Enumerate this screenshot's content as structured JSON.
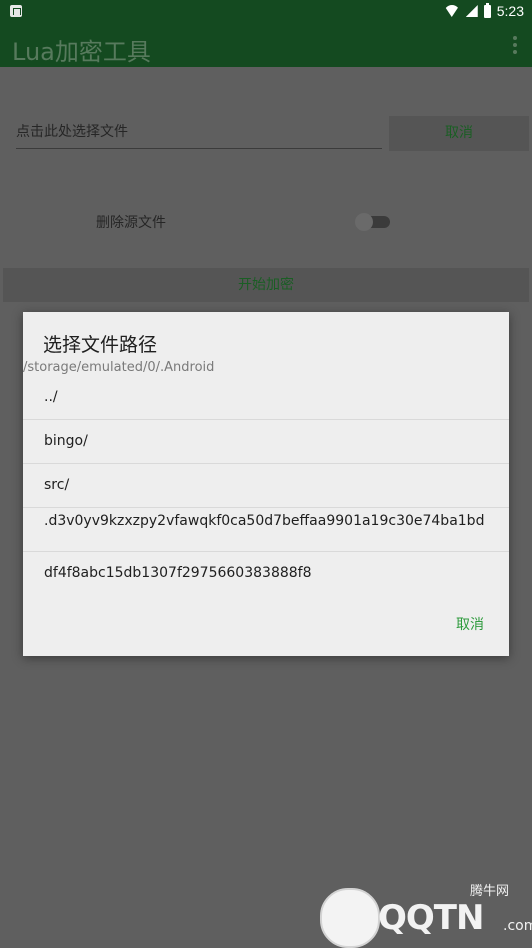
{
  "status_bar": {
    "time": "5:23",
    "icons": [
      "notification-icon",
      "wifi-icon",
      "signal-icon",
      "battery-icon"
    ]
  },
  "app": {
    "title": "Lua加密工具",
    "menu_icon": "more-vert-icon"
  },
  "main": {
    "file_input_placeholder": "点击此处选择文件",
    "cancel_label": "取消",
    "delete_source_label": "删除源文件",
    "delete_source_enabled": false,
    "start_button_label": "开始加密"
  },
  "dialog": {
    "title": "选择文件路径",
    "path": "/storage/emulated/0/.Android",
    "items": [
      {
        "label": "../"
      },
      {
        "label": "bingo/"
      },
      {
        "label": "src/"
      },
      {
        "label": ".d3v0yv9kzxzpy2vfawqkf0ca50d7beffaa9901a19c30e74ba1bd"
      },
      {
        "label": "df4f8abc15db1307f2975660383888f8"
      }
    ],
    "cancel_label": "取消"
  },
  "watermark": {
    "badge": "腾牛网",
    "brand": "QQTN",
    "suffix": ".com"
  },
  "colors": {
    "app_bar": "#144a20",
    "accent": "#2e9b3d",
    "scrim_bg": "#5f5f5f",
    "dialog_bg": "#eeeeee"
  }
}
